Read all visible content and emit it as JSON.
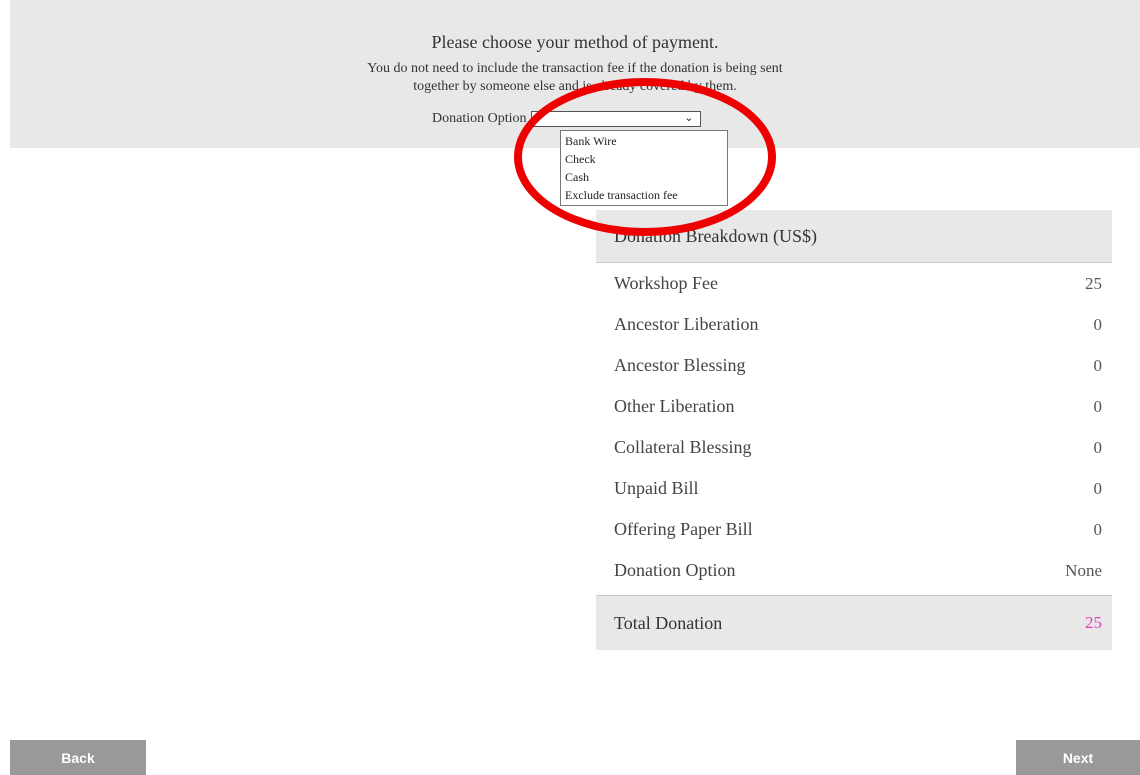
{
  "payment": {
    "title": "Please choose your method of payment.",
    "note_line1": "You do not need to include the transaction fee if the donation is being sent",
    "note_line2": "together by someone else and is already covered by them.",
    "option_label": "Donation Option",
    "select_value": "",
    "dropdown_options": [
      "Bank Wire",
      "Check",
      "Cash",
      "Exclude transaction fee"
    ]
  },
  "breakdown": {
    "title": "Donation Breakdown (US$)",
    "rows": [
      {
        "label": "Workshop Fee",
        "value": "25"
      },
      {
        "label": "Ancestor Liberation",
        "value": "0"
      },
      {
        "label": "Ancestor Blessing",
        "value": "0"
      },
      {
        "label": "Other Liberation",
        "value": "0"
      },
      {
        "label": "Collateral Blessing",
        "value": "0"
      },
      {
        "label": "Unpaid Bill",
        "value": "0"
      },
      {
        "label": "Offering Paper Bill",
        "value": "0"
      },
      {
        "label": "Donation Option",
        "value": "None"
      }
    ],
    "total_label": "Total Donation",
    "total_value": "25"
  },
  "nav": {
    "back_label": "Back",
    "next_label": "Next"
  },
  "colors": {
    "panel": "#e8e8e8",
    "highlight": "#ee0000",
    "total_value": "#e040c0",
    "button": "#999999"
  },
  "icons": {
    "select_arrow": "chevron-down-icon"
  }
}
